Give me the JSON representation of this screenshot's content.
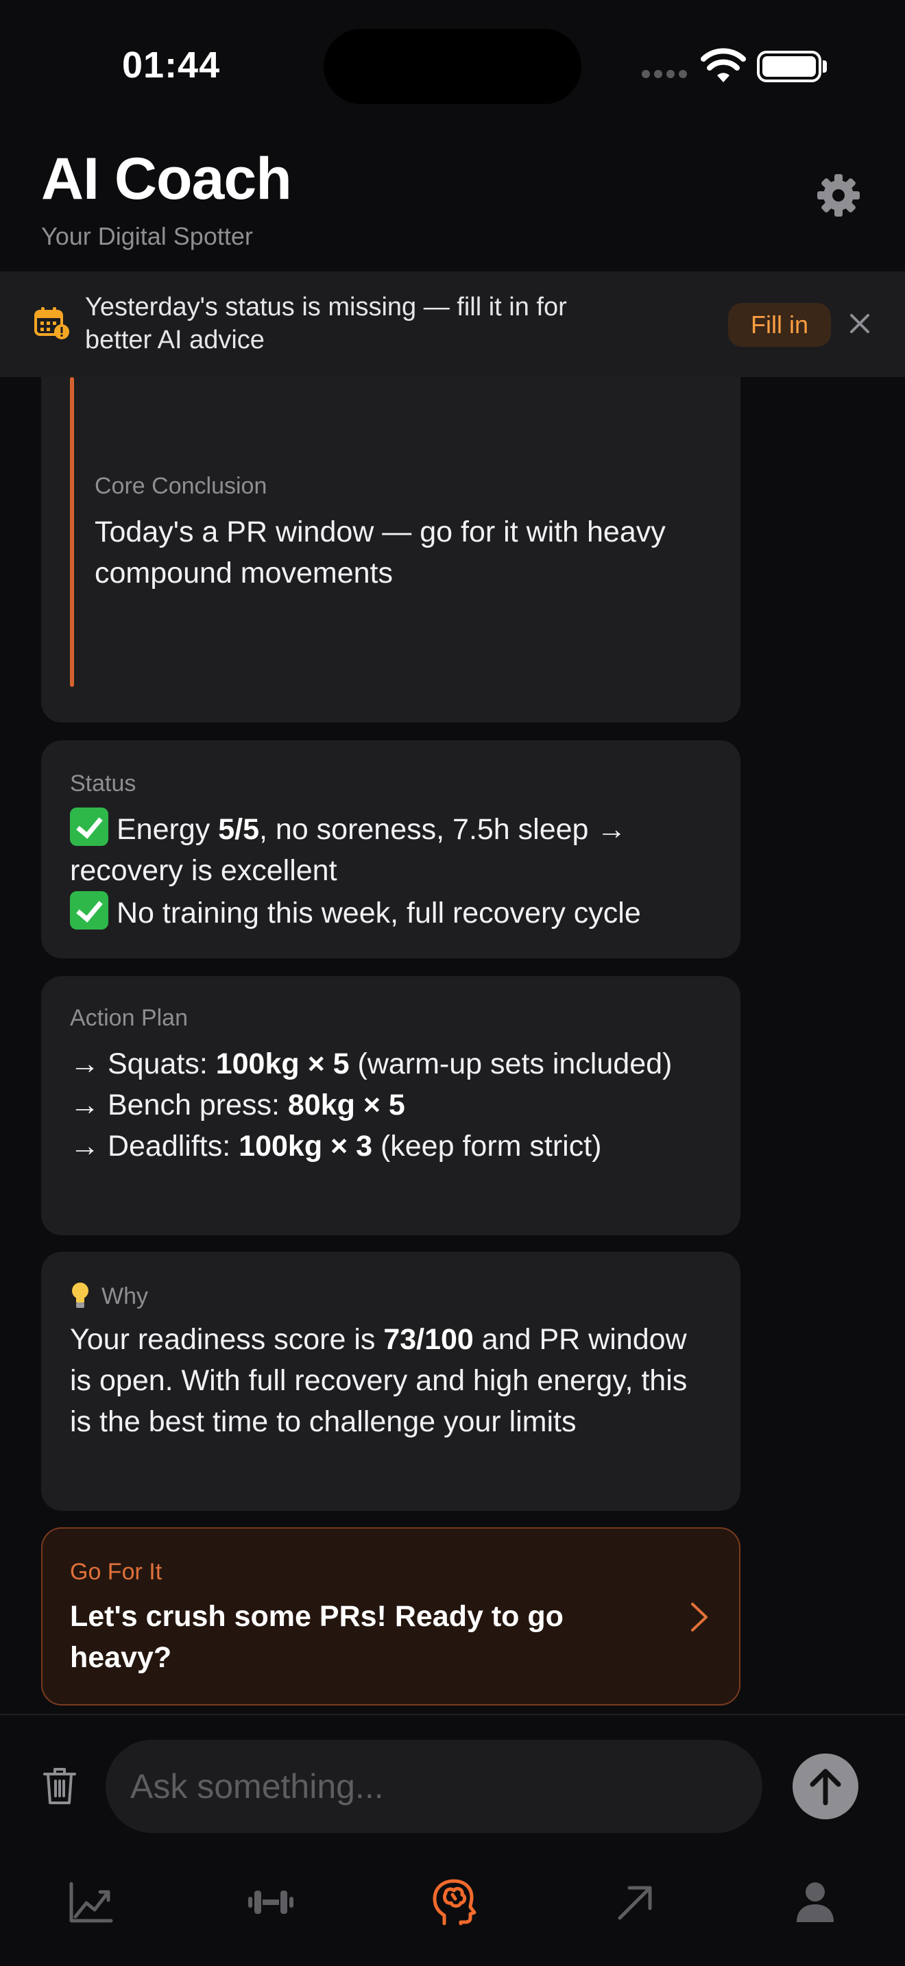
{
  "status_bar": {
    "time": "01:44"
  },
  "header": {
    "title": "AI Coach",
    "subtitle": "Your Digital Spotter"
  },
  "banner": {
    "message": "Yesterday's status is missing — fill it in for better AI advice",
    "fill_label": "Fill in"
  },
  "core": {
    "label": "Core Conclusion",
    "text": "Today's a PR window — go for it with heavy compound movements"
  },
  "status_card": {
    "label": "Status",
    "line1_prefix": "Energy ",
    "line1_bold": "5/5",
    "line1_suffix": ", no soreness, 7.5h sleep → recovery is excellent",
    "line2": "No training this week, full recovery cycle"
  },
  "action_plan": {
    "label": "Action Plan",
    "items": [
      {
        "arrow": "→",
        "name": "Squats: ",
        "bold": "100kg × 5",
        "note": " (warm-up sets included)"
      },
      {
        "arrow": "→",
        "name": "Bench press: ",
        "bold": "80kg × 5",
        "note": ""
      },
      {
        "arrow": "→",
        "name": "Deadlifts: ",
        "bold": "100kg × 3",
        "note": " (keep form strict)"
      }
    ]
  },
  "why": {
    "label": "Why",
    "text_prefix": "Your readiness score is ",
    "text_bold": "73/100",
    "text_suffix": " and PR window is open. With full recovery and high energy, this is the best time to challenge your limits"
  },
  "cta": {
    "label": "Go For It",
    "text": "Let's crush some PRs! Ready to go heavy?"
  },
  "input": {
    "placeholder": "Ask something..."
  },
  "tabs": [
    {
      "icon": "trend-chart-icon",
      "active": false
    },
    {
      "icon": "dumbbell-icon",
      "active": false
    },
    {
      "icon": "brain-head-icon",
      "active": true
    },
    {
      "icon": "arrow-up-right-icon",
      "active": false
    },
    {
      "icon": "person-icon",
      "active": false
    }
  ],
  "colors": {
    "accent": "#ff9f43",
    "accent_deep": "#e0713a",
    "card_bg": "#1e1e21",
    "page_bg": "#0c0c0e",
    "check_green": "#2fb84a"
  }
}
